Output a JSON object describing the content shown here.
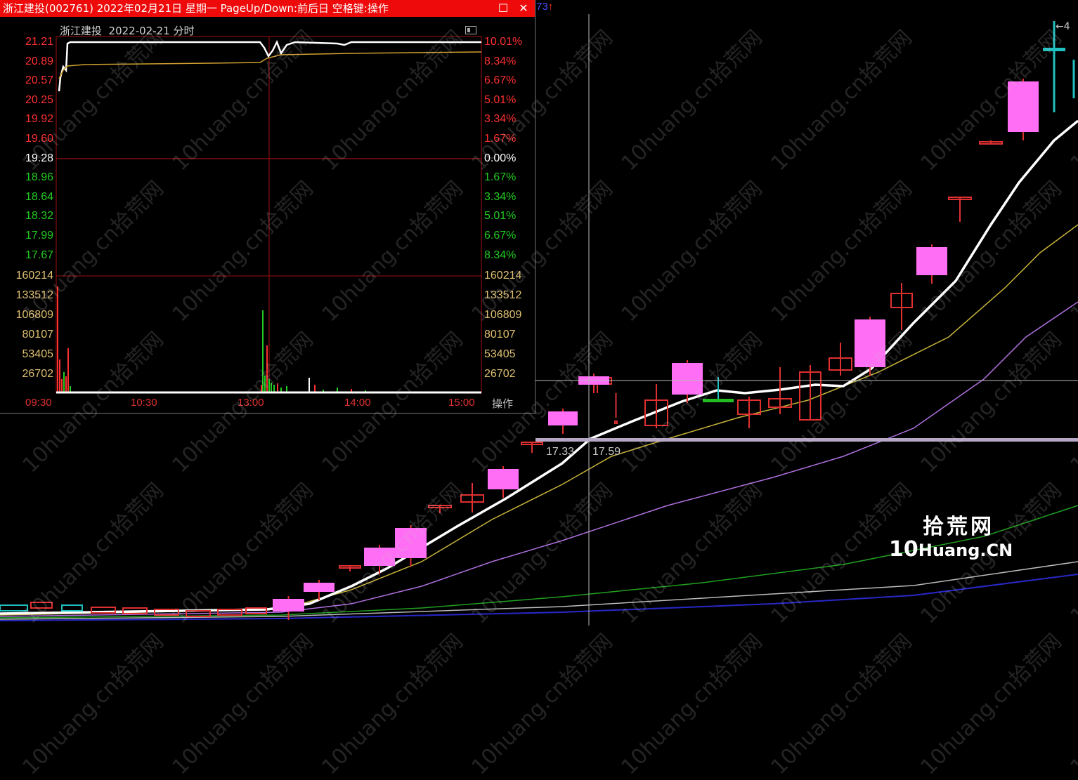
{
  "window": {
    "title": "浙江建投(002761) 2022年02月21日 星期一 PageUp/Down:前后日 空格键:操作",
    "restore_glyph": "☐",
    "close_glyph": "✕"
  },
  "chart_header": {
    "code_fragment": "73",
    "arrow": "↑",
    "top_right_fragment": "←4"
  },
  "intraday": {
    "subtitle": "浙江建投  2022-02-21 分时",
    "price_labels": [
      "21.21",
      "20.89",
      "20.57",
      "20.25",
      "19.92",
      "19.60",
      "19.28",
      "18.96",
      "18.64",
      "18.32",
      "17.99",
      "17.67"
    ],
    "pct_labels": [
      "10.01%",
      "8.34%",
      "6.67%",
      "5.01%",
      "3.34%",
      "1.67%",
      "0.00%",
      "1.67%",
      "3.34%",
      "5.01%",
      "6.67%",
      "8.34%"
    ],
    "volume_labels": [
      "160214",
      "133512",
      "106809",
      "80107",
      "53405",
      "26702"
    ],
    "time_labels": [
      "09:30",
      "10:30",
      "13:00",
      "14:00",
      "15:00"
    ],
    "operate_label": "操作",
    "colors": {
      "up": "#ff3030",
      "down": "#22cc22",
      "flat": "#ffffff",
      "volume_axis": "#e0c070"
    }
  },
  "daily": {
    "crosshair_low": "17.33",
    "crosshair_high": "17.59",
    "colors": {
      "up_candle": "#ff6ef5",
      "red_candle": "#e03030",
      "ma5": "#ffffff",
      "ma10": "#c8b43c",
      "ma20": "#b070e0",
      "ma60": "#20a020",
      "ma120": "#bbbbbb",
      "ma250": "#2828c8"
    }
  },
  "logo": {
    "cn": "拾荒网",
    "en_prefix": "10",
    "en_rest": "Huang",
    "en_suffix": ".CN"
  },
  "watermark_text": "10huang.cn拾荒网"
}
